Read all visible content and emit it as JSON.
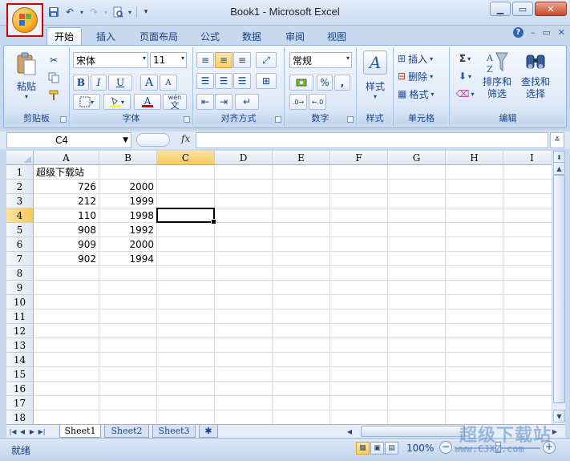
{
  "app": {
    "window_title": "Book1 - Microsoft Excel"
  },
  "ribbon": {
    "tabs": [
      "开始",
      "插入",
      "页面布局",
      "公式",
      "数据",
      "审阅",
      "视图"
    ],
    "active_tab": "开始",
    "groups": {
      "clipboard": {
        "label": "剪贴板",
        "paste_label": "粘贴"
      },
      "font": {
        "label": "字体",
        "font_name": "宋体",
        "font_size": "11",
        "bold": "B",
        "italic": "I",
        "underline": "U",
        "grow": "A",
        "shrink": "A",
        "font_color": "A",
        "phonetic": "wén"
      },
      "alignment": {
        "label": "对齐方式"
      },
      "number": {
        "label": "数字",
        "format": "常规",
        "percent": "%",
        "comma": ","
      },
      "styles": {
        "label": "样式",
        "styles_label": "样式"
      },
      "cells": {
        "label": "单元格",
        "insert_label": "插入",
        "delete_label": "删除",
        "format_label": "格式"
      },
      "editing": {
        "label": "编辑",
        "sort_filter_label": "排序和\n筛选",
        "find_select_label": "查找和\n选择",
        "sum_symbol": "Σ"
      }
    }
  },
  "formula_bar": {
    "name_box": "C4",
    "fx_label": "fx",
    "formula": ""
  },
  "sheet": {
    "columns": [
      "A",
      "B",
      "C",
      "D",
      "E",
      "F",
      "G",
      "H",
      "I"
    ],
    "rows": [
      "1",
      "2",
      "3",
      "4",
      "5",
      "6",
      "7",
      "8",
      "9",
      "10",
      "11",
      "12",
      "13",
      "14",
      "15",
      "16",
      "17",
      "18"
    ],
    "selected_cell": "C4",
    "cells": [
      {
        "ref": "A1",
        "value": "超级下载站",
        "type": "text"
      },
      {
        "ref": "A2",
        "value": "726",
        "type": "num"
      },
      {
        "ref": "B2",
        "value": "2000",
        "type": "num"
      },
      {
        "ref": "A3",
        "value": "212",
        "type": "num"
      },
      {
        "ref": "B3",
        "value": "1999",
        "type": "num"
      },
      {
        "ref": "A4",
        "value": "110",
        "type": "num"
      },
      {
        "ref": "B4",
        "value": "1998",
        "type": "num"
      },
      {
        "ref": "A5",
        "value": "908",
        "type": "num"
      },
      {
        "ref": "B5",
        "value": "1992",
        "type": "num"
      },
      {
        "ref": "A6",
        "value": "909",
        "type": "num"
      },
      {
        "ref": "B6",
        "value": "2000",
        "type": "num"
      },
      {
        "ref": "A7",
        "value": "902",
        "type": "num"
      },
      {
        "ref": "B7",
        "value": "1994",
        "type": "num"
      }
    ]
  },
  "sheet_tabs": [
    "Sheet1",
    "Sheet2",
    "Sheet3"
  ],
  "active_sheet": "Sheet1",
  "status": {
    "text": "就绪",
    "zoom": "100%"
  },
  "watermark": {
    "title": "超级下载站",
    "url": "www.CJXZ.com"
  },
  "colors": {
    "ribbon_text": "#15428b",
    "selection_header": "#f8c95d",
    "office_button_highlight": "#d40000"
  }
}
